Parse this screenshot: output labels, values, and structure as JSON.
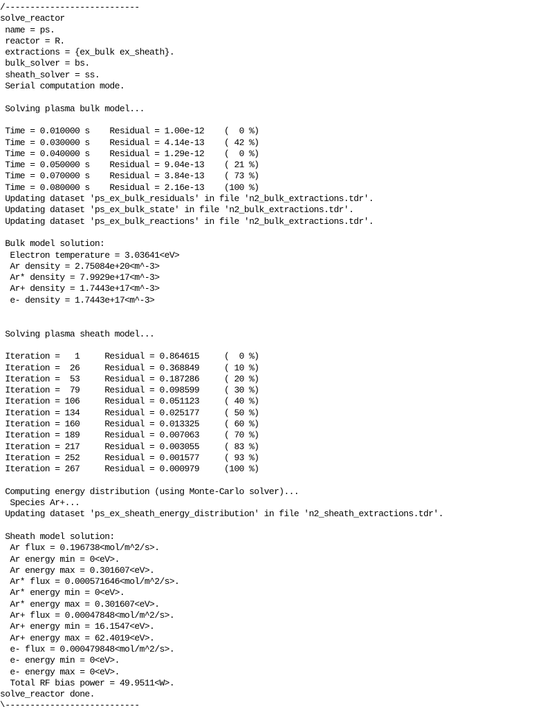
{
  "console": {
    "lines": [
      "/---------------------------",
      "solve_reactor",
      " name = ps.",
      " reactor = R.",
      " extractions = {ex_bulk ex_sheath}.",
      " bulk_solver = bs.",
      " sheath_solver = ss.",
      " Serial computation mode.",
      "",
      " Solving plasma bulk model...",
      "",
      " Time = 0.010000 s    Residual = 1.00e-12    (  0 %)",
      " Time = 0.030000 s    Residual = 4.14e-13    ( 42 %)",
      " Time = 0.040000 s    Residual = 1.29e-12    (  0 %)",
      " Time = 0.050000 s    Residual = 9.04e-13    ( 21 %)",
      " Time = 0.070000 s    Residual = 3.84e-13    ( 73 %)",
      " Time = 0.080000 s    Residual = 2.16e-13    (100 %)",
      " Updating dataset 'ps_ex_bulk_residuals' in file 'n2_bulk_extractions.tdr'.",
      " Updating dataset 'ps_ex_bulk_state' in file 'n2_bulk_extractions.tdr'.",
      " Updating dataset 'ps_ex_bulk_reactions' in file 'n2_bulk_extractions.tdr'.",
      "",
      " Bulk model solution:",
      "  Electron temperature = 3.03641<eV>",
      "  Ar density = 2.75084e+20<m^-3>",
      "  Ar* density = 7.9929e+17<m^-3>",
      "  Ar+ density = 1.7443e+17<m^-3>",
      "  e- density = 1.7443e+17<m^-3>",
      "",
      "",
      " Solving plasma sheath model...",
      "",
      " Iteration =   1     Residual = 0.864615     (  0 %)",
      " Iteration =  26     Residual = 0.368849     ( 10 %)",
      " Iteration =  53     Residual = 0.187286     ( 20 %)",
      " Iteration =  79     Residual = 0.098599     ( 30 %)",
      " Iteration = 106     Residual = 0.051123     ( 40 %)",
      " Iteration = 134     Residual = 0.025177     ( 50 %)",
      " Iteration = 160     Residual = 0.013325     ( 60 %)",
      " Iteration = 189     Residual = 0.007063     ( 70 %)",
      " Iteration = 217     Residual = 0.003055     ( 83 %)",
      " Iteration = 252     Residual = 0.001577     ( 93 %)",
      " Iteration = 267     Residual = 0.000979     (100 %)",
      "",
      " Computing energy distribution (using Monte-Carlo solver)...",
      "  Species Ar+...",
      " Updating dataset 'ps_ex_sheath_energy_distribution' in file 'n2_sheath_extractions.tdr'.",
      "",
      " Sheath model solution:",
      "  Ar flux = 0.196738<mol/m^2/s>.",
      "  Ar energy min = 0<eV>.",
      "  Ar energy max = 0.301607<eV>.",
      "  Ar* flux = 0.000571646<mol/m^2/s>.",
      "  Ar* energy min = 0<eV>.",
      "  Ar* energy max = 0.301607<eV>.",
      "  Ar+ flux = 0.00047848<mol/m^2/s>.",
      "  Ar+ energy min = 16.1547<eV>.",
      "  Ar+ energy max = 62.4019<eV>.",
      "  e- flux = 0.000479848<mol/m^2/s>.",
      "  e- energy min = 0<eV>.",
      "  e- energy max = 0<eV>.",
      "  Total RF bias power = 49.9511<W>.",
      "solve_reactor done.",
      "\\---------------------------"
    ]
  }
}
